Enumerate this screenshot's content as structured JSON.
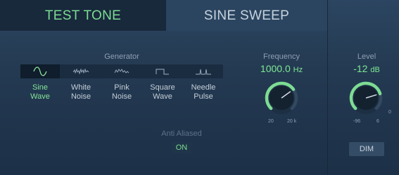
{
  "tabs": {
    "test_tone": "TEST TONE",
    "sine_sweep": "SINE SWEEP"
  },
  "generator": {
    "label": "Generator",
    "selected": "sine",
    "items": [
      {
        "id": "sine",
        "line1": "Sine",
        "line2": "Wave",
        "icon": "sine-wave-icon"
      },
      {
        "id": "white",
        "line1": "White",
        "line2": "Noise",
        "icon": "white-noise-icon"
      },
      {
        "id": "pink",
        "line1": "Pink",
        "line2": "Noise",
        "icon": "pink-noise-icon"
      },
      {
        "id": "square",
        "line1": "Square",
        "line2": "Wave",
        "icon": "square-wave-icon"
      },
      {
        "id": "needle",
        "line1": "Needle",
        "line2": "Pulse",
        "icon": "needle-pulse-icon"
      }
    ]
  },
  "anti_aliased": {
    "label": "Anti Aliased",
    "state": "ON"
  },
  "frequency": {
    "label": "Frequency",
    "value": "1000.0",
    "unit": "Hz",
    "min_label": "20",
    "max_label": "20 k",
    "knob_fraction": 0.7
  },
  "level": {
    "label": "Level",
    "value": "-12",
    "unit": "dB",
    "min_label": "-96",
    "max_label": "6",
    "zero_label": "0",
    "knob_fraction": 0.77
  },
  "dim": {
    "label": "DIM"
  },
  "colors": {
    "accent": "#7ddc93",
    "text_muted": "#8ea0b2",
    "background": "#243a52"
  }
}
